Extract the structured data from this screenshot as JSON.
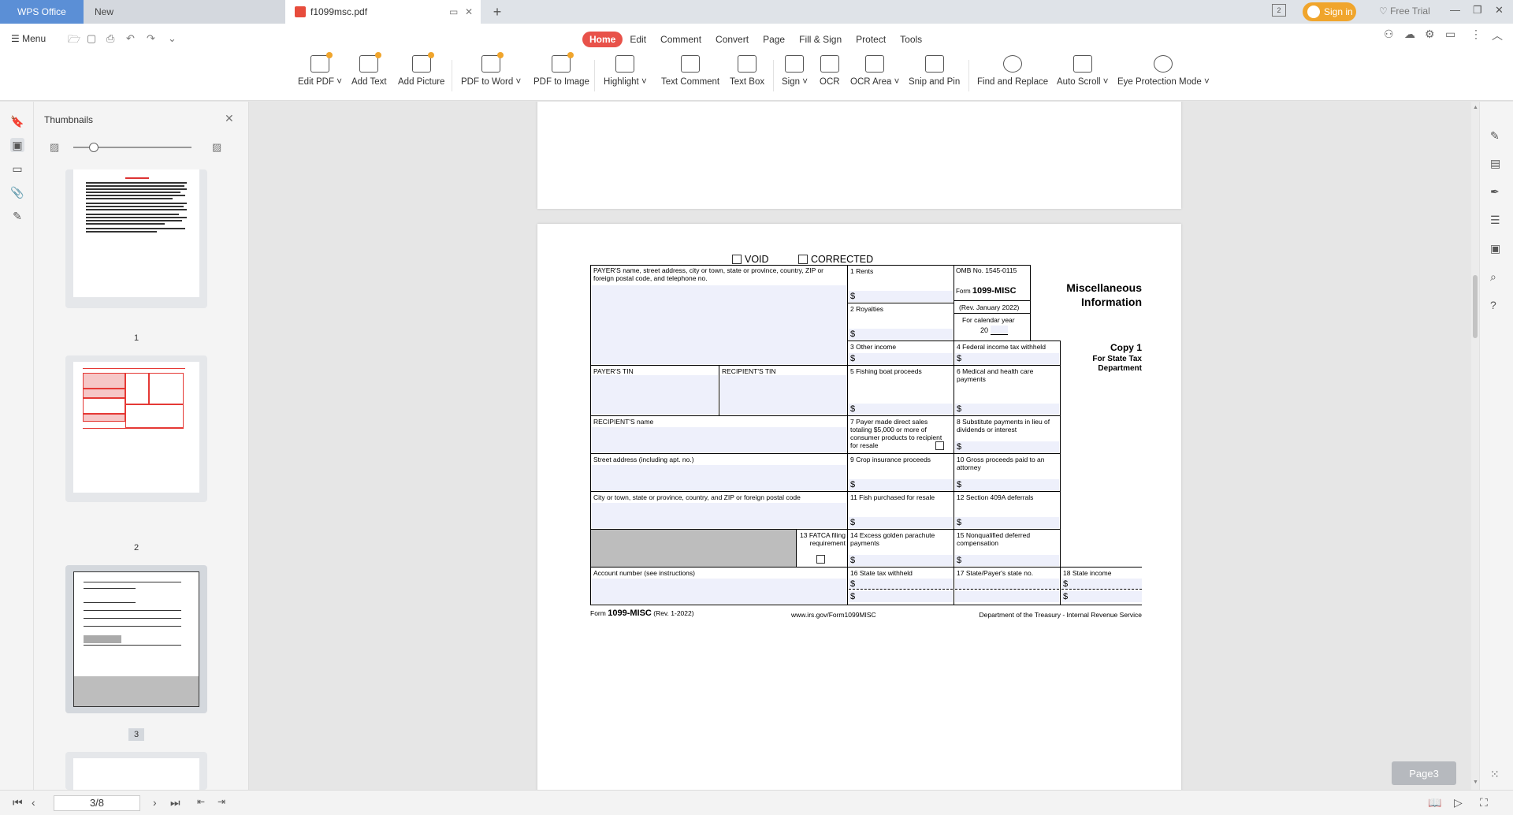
{
  "titlebar": {
    "app_tab": "WPS Office",
    "new_tab": "New",
    "doc_tab": "f1099msc.pdf",
    "signin": "Sign in",
    "free_trial": "Free Trial",
    "tab_count": "2"
  },
  "toolbar": {
    "menu": "Menu",
    "tabs": [
      "Home",
      "Edit",
      "Comment",
      "Convert",
      "Page",
      "Fill & Sign",
      "Protect",
      "Tools"
    ],
    "tools": [
      "Edit PDF",
      "Add Text",
      "Add Picture",
      "PDF to Word",
      "PDF to Image",
      "Highlight",
      "Text Comment",
      "Text Box",
      "Sign",
      "OCR",
      "OCR Area",
      "Snip and Pin",
      "Find and Replace",
      "Auto Scroll",
      "Eye Protection Mode"
    ]
  },
  "thumbnails": {
    "title": "Thumbnails",
    "page_labels": [
      "1",
      "2",
      "3"
    ]
  },
  "form": {
    "void": "VOID",
    "corrected": "CORRECTED",
    "payer_name": "PAYER'S name, street address, city or town, state or province, country, ZIP or foreign postal code, and telephone no.",
    "omb": "OMB No. 1545-0115",
    "form_prefix": "Form",
    "form_name": "1099-MISC",
    "rev": "(Rev. January 2022)",
    "cal_year": "For calendar year",
    "year_prefix": "20",
    "title": "Miscellaneous Information",
    "b1": "1 Rents",
    "b2": "2 Royalties",
    "b3": "3 Other income",
    "b4": "4 Federal income tax withheld",
    "copy": "Copy 1",
    "copy_sub": "For State Tax Department",
    "payer_tin": "PAYER'S TIN",
    "recipient_tin": "RECIPIENT'S TIN",
    "b5": "5 Fishing boat proceeds",
    "b6": "6 Medical and health care payments",
    "recipient_name": "RECIPIENT'S name",
    "b7": "7 Payer made direct sales totaling $5,000 or more of consumer products to recipient for resale",
    "b8": "8 Substitute payments in lieu of dividends or interest",
    "street": "Street address (including apt. no.)",
    "b9": "9 Crop insurance proceeds",
    "b10": "10 Gross proceeds paid to an attorney",
    "city": "City or town, state or province, country, and ZIP or foreign postal code",
    "b11": "11 Fish purchased for resale",
    "b12": "12 Section 409A deferrals",
    "b13": "13 FATCA filing requirement",
    "b14": "14 Excess golden parachute payments",
    "b15": "15 Nonqualified deferred compensation",
    "account": "Account number (see instructions)",
    "b16": "16 State tax withheld",
    "b17": "17 State/Payer's state no.",
    "b18": "18 State income",
    "dollar": "$",
    "footer_form": "Form",
    "footer_name": "1099-MISC",
    "footer_rev": "(Rev. 1-2022)",
    "footer_url": "www.irs.gov/Form1099MISC",
    "footer_dept": "Department of the Treasury - Internal Revenue Service"
  },
  "viewer": {
    "page_badge": "Page3"
  },
  "status": {
    "page_field": "3/8"
  }
}
